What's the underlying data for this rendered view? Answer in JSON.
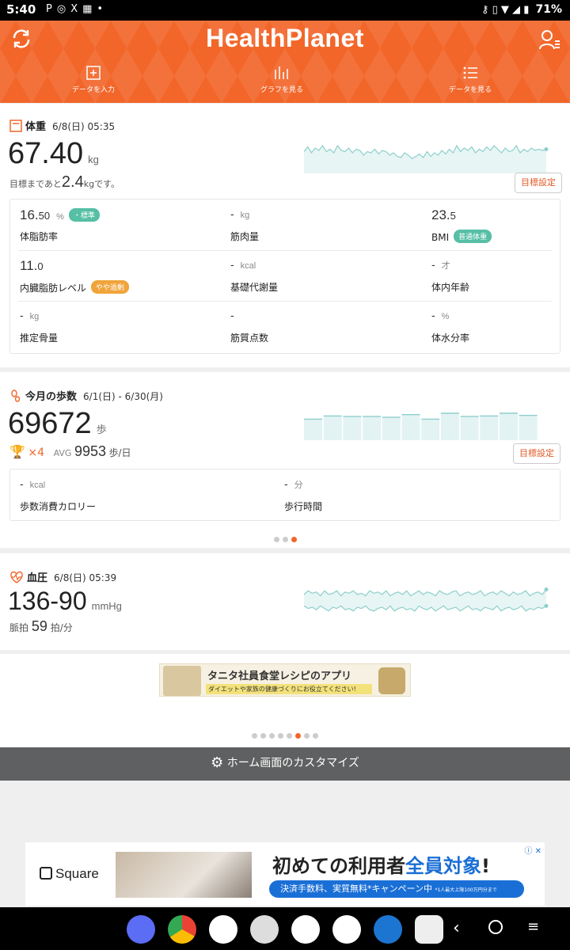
{
  "status_bar": {
    "time": "5:40",
    "icons": [
      "P",
      "◎",
      "X",
      "▦",
      "•"
    ],
    "battery": "71%"
  },
  "header": {
    "logo": "HealthPlanet",
    "nav": [
      "データを入力",
      "グラフを見る",
      "データを見る"
    ]
  },
  "weight": {
    "title": "体重",
    "date": "6/8(日) 05:35",
    "value_int": "67.",
    "value_dec": "40",
    "unit": "kg",
    "goal_prefix": "目標まであと",
    "goal_value": "2.4",
    "goal_unit": "kg",
    "goal_suffix": "です。",
    "goal_button": "目標設定",
    "metrics": [
      {
        "value": "16.",
        "dec": "50",
        "unit": "%",
        "label": "体脂肪率",
        "badge": "・標準",
        "badge_color": "#56bfa5"
      },
      {
        "value": "-",
        "dec": "",
        "unit": "kg",
        "label": "筋肉量"
      },
      {
        "value": "23.",
        "dec": "5",
        "unit": "",
        "label": "BMI",
        "badge": "普通体重",
        "badge_color": "#56bfa5"
      },
      {
        "value": "11.",
        "dec": "0",
        "unit": "",
        "label": "内臓脂肪レベル",
        "badge": "やや過剰",
        "badge_color": "#f0a43a"
      },
      {
        "value": "-",
        "dec": "",
        "unit": "kcal",
        "label": "基礎代謝量"
      },
      {
        "value": "-",
        "dec": "",
        "unit": "才",
        "label": "体内年齢"
      },
      {
        "value": "-",
        "dec": "",
        "unit": "kg",
        "label": "推定骨量"
      },
      {
        "value": "-",
        "dec": "",
        "unit": "",
        "label": "筋質点数"
      },
      {
        "value": "-",
        "dec": "",
        "unit": "%",
        "label": "体水分率"
      }
    ]
  },
  "steps": {
    "title": "今月の歩数",
    "date": "6/1(日) - 6/30(月)",
    "value": "69672",
    "unit": "歩",
    "trophy_count": "×4",
    "avg_label": "AVG",
    "avg_value": "9953",
    "avg_unit": "歩/日",
    "goal_button": "目標設定",
    "metrics": [
      {
        "value": "-",
        "unit": "kcal",
        "label": "歩数消費カロリー"
      },
      {
        "value": "-",
        "unit": "分",
        "label": "歩行時間"
      }
    ],
    "page_indicator": {
      "total": 3,
      "active": 3
    }
  },
  "bp": {
    "title": "血圧",
    "date": "6/8(日) 05:39",
    "value": "136-90",
    "unit": "mmHg",
    "pulse_label": "脈拍",
    "pulse_value": "59",
    "pulse_unit": "拍/分"
  },
  "banner": {
    "title": "タニタ社員食堂レシピのアプリ",
    "subtitle": "ダイエットや家族の健康づくりにお役立てください!",
    "page_indicator": {
      "total": 8,
      "active": 6
    }
  },
  "customize": {
    "label": "ホーム画面のカスタマイズ"
  },
  "ad": {
    "brand": "Square",
    "headline_prefix": "初めての利用者",
    "headline_emph": "全員対象",
    "headline_suffix": "!",
    "sub": "決済手数料、実質無料",
    "sub_mark": "*",
    "sub_suffix": "キャンペーン中",
    "note": "*1人最大上限100万円分まで"
  },
  "colors": {
    "brand": "#f2662a",
    "teal": "#56bfa5",
    "chart": "#8ccfcc"
  },
  "weight_chart": {
    "type": "line",
    "points": [
      0.55,
      0.35,
      0.6,
      0.4,
      0.5,
      0.3,
      0.55,
      0.45,
      0.6,
      0.3,
      0.5,
      0.55,
      0.4,
      0.6,
      0.45,
      0.5,
      0.7,
      0.55,
      0.6,
      0.45,
      0.65,
      0.5,
      0.55,
      0.7,
      0.6,
      0.75,
      0.8,
      0.6,
      0.7,
      0.85,
      0.75,
      0.65,
      0.8,
      0.55,
      0.75,
      0.6,
      0.7,
      0.5,
      0.65,
      0.45,
      0.6,
      0.3,
      0.55,
      0.4,
      0.5,
      0.35,
      0.6,
      0.45,
      0.55,
      0.35,
      0.5,
      0.3,
      0.45,
      0.6,
      0.4,
      0.55,
      0.5,
      0.3,
      0.6,
      0.45,
      0.55,
      0.4,
      0.5,
      0.45,
      0.5,
      0.45
    ]
  },
  "steps_chart": {
    "type": "bar",
    "values": [
      0.78,
      0.9,
      0.88,
      0.88,
      0.85,
      0.95,
      0.78,
      1.0,
      0.88,
      0.9,
      1.0,
      0.92
    ]
  },
  "bp_chart": {
    "type": "line",
    "upper": [
      0.25,
      0.1,
      0.2,
      0.15,
      0.3,
      0.1,
      0.25,
      0.2,
      0.1,
      0.3,
      0.15,
      0.2,
      0.1,
      0.25,
      0.2,
      0.3,
      0.1,
      0.2,
      0.15,
      0.25,
      0.1,
      0.3,
      0.2,
      0.15,
      0.25,
      0.1,
      0.3,
      0.2,
      0.1,
      0.25,
      0.15,
      0.2,
      0.3,
      0.1,
      0.2,
      0.25,
      0.15,
      0.1,
      0.3,
      0.2,
      0.15,
      0.25,
      0.2,
      0.1,
      0.3,
      0.2,
      0.15,
      0.25,
      0.1,
      0.2,
      0.3,
      0.15,
      0.25,
      0.2,
      0.1,
      0.3,
      0.2,
      0.15,
      0.25,
      0.05
    ],
    "lower": [
      0.7,
      0.8,
      0.75,
      0.85,
      0.7,
      0.8,
      0.9,
      0.75,
      0.8,
      0.7,
      0.85,
      0.8,
      0.9,
      0.75,
      0.8,
      0.7,
      0.85,
      0.9,
      0.8,
      0.75,
      0.85,
      0.7,
      0.9,
      0.8,
      0.75,
      0.85,
      0.8,
      0.9,
      0.7,
      0.8,
      0.85,
      0.75,
      0.9,
      0.8,
      0.7,
      0.85,
      0.8,
      0.75,
      0.9,
      0.8,
      0.7,
      0.85,
      0.8,
      0.9,
      0.75,
      0.8,
      0.85,
      0.7,
      0.9,
      0.8,
      0.75,
      0.85,
      0.8,
      0.7,
      0.9,
      0.8,
      0.85,
      0.75,
      0.8,
      0.7
    ]
  }
}
